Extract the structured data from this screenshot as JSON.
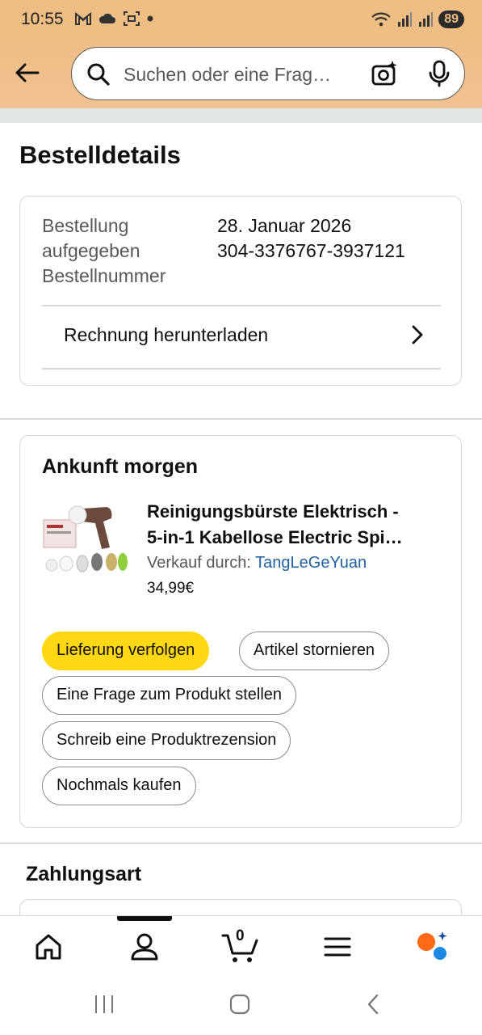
{
  "status_bar": {
    "time": "10:55",
    "battery": "89",
    "left_icons": [
      "gmail-icon",
      "cloud-icon",
      "screenshot-icon",
      "dot-icon"
    ],
    "right_icons": [
      "wifi-icon",
      "signal-icon",
      "signal-icon-2",
      "battery-icon"
    ]
  },
  "header": {
    "search_placeholder": "Suchen oder eine Frag…"
  },
  "page": {
    "title": "Bestelldetails"
  },
  "order_info": {
    "label_placed_line1": "Bestellung",
    "label_placed_line2": "aufgegeben",
    "label_number": "Bestellnummer",
    "date": "28. Januar 2026",
    "order_number": "304-3376767-3937121",
    "invoice_link": "Rechnung herunterladen"
  },
  "shipment": {
    "title": "Ankunft morgen",
    "product_line1": "Reinigungsbürste Elektrisch -",
    "product_line2": "5-in-1 Kabellose Electric Spi…",
    "seller_label": "Verkauf durch: ",
    "seller_name": "TangLeGeYuan",
    "price": "34,99€",
    "actions": {
      "track": "Lieferung verfolgen",
      "cancel": "Artikel stornieren",
      "ask": "Eine Frage zum Produkt stellen",
      "review": "Schreib eine Produktrezension",
      "buy_again": "Nochmals kaufen"
    }
  },
  "payment": {
    "title": "Zahlungsart"
  },
  "bottom_nav": {
    "cart_count": "0",
    "items": [
      "home-icon",
      "account-icon",
      "cart-icon",
      "menu-icon",
      "rufus-icon"
    ],
    "active": "account-icon"
  },
  "colors": {
    "header_bg": "#eebd84",
    "primary_button": "#ffd814",
    "link": "#2162a1",
    "border": "#d5d9d9"
  }
}
